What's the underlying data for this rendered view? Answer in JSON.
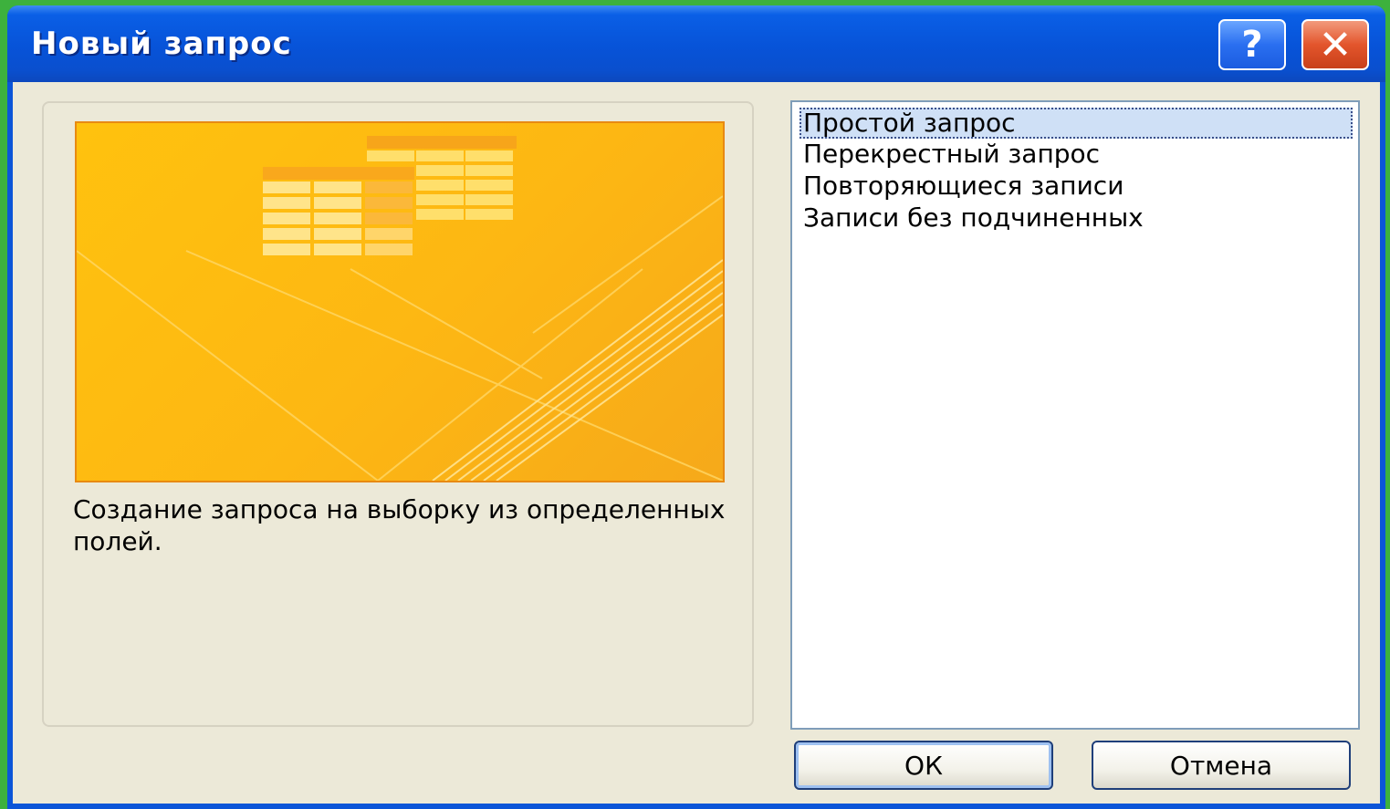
{
  "window": {
    "title": "Новый запрос",
    "help_label": "?",
    "close_label": "✕"
  },
  "preview": {
    "description": "Создание запроса на выборку из определенных полей."
  },
  "query_types": {
    "items": [
      {
        "label": "Простой запрос",
        "selected": true
      },
      {
        "label": "Перекрестный запрос",
        "selected": false
      },
      {
        "label": "Повторяющиеся записи",
        "selected": false
      },
      {
        "label": "Записи без подчиненных",
        "selected": false
      }
    ]
  },
  "buttons": {
    "ok_label": "ОК",
    "cancel_label": "Отмена"
  },
  "colors": {
    "titlebar": "#0753d8",
    "dialog_bg": "#ece9d8",
    "preview_bg": "#fdb713",
    "selection_bg": "#cfe0f6",
    "desktop": "#3db13d"
  }
}
